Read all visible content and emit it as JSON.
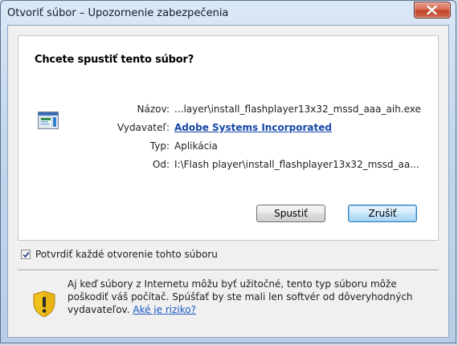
{
  "window": {
    "title": "Otvoriť súbor – Upozornenie zabezpečenia"
  },
  "content": {
    "heading": "Chcete spustiť tento súbor?",
    "icons": {
      "file": "application-window-icon",
      "close": "close-x-icon",
      "warning": "security-shield-warning-icon",
      "check": "checkmark-icon"
    },
    "fields": {
      "name_label": "Názov:",
      "name_value": "...layer\\install_flashplayer13x32_mssd_aaa_aih.exe",
      "publisher_label": "Vydavateľ:",
      "publisher_value": "Adobe Systems Incorporated",
      "type_label": "Typ:",
      "type_value": "Aplikácia",
      "from_label": "Od:",
      "from_value": "I:\\Flash player\\install_flashplayer13x32_mssd_aa..."
    }
  },
  "buttons": {
    "run": "Spustiť",
    "cancel": "Zrušiť"
  },
  "checkbox": {
    "label": "Potvrdiť každé otvorenie tohto súboru",
    "checked": true
  },
  "warning": {
    "text": "Aj keď súbory z Internetu môžu byť užitočné, tento typ súboru môže poškodiť váš počítač. Spúšťať by ste mali len softvér od dôveryhodných vydavateľov.",
    "link": "Aké je riziko?"
  },
  "colors": {
    "link": "#1546a8",
    "close_button": "#c0442a",
    "shield_yellow": "#f2c21c"
  }
}
